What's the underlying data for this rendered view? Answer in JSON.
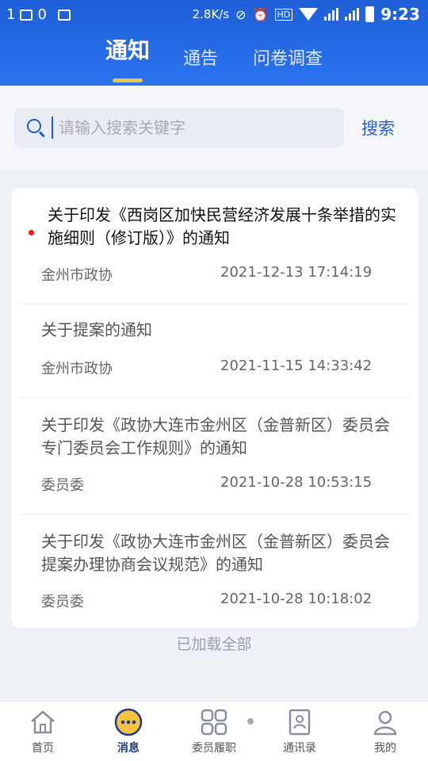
{
  "status_bar": {
    "left_text": "1",
    "left_text2": "0",
    "speed": "2.8K/s",
    "time": "9:23"
  },
  "tabs": [
    {
      "label": "通知",
      "active": true
    },
    {
      "label": "通告",
      "active": false
    },
    {
      "label": "问卷调查",
      "active": false
    }
  ],
  "search": {
    "placeholder": "请输入搜索关键字",
    "value": "",
    "button_label": "搜索"
  },
  "notices": [
    {
      "title": "关于印发《西岗区加快民营经济发展十条举措的实施细则（修订版）》的通知",
      "source": "金州市政协",
      "time": "2021-12-13 17:14:19",
      "unread": true
    },
    {
      "title": "关于提案的通知",
      "source": "金州市政协",
      "time": "2021-11-15 14:33:42",
      "unread": false
    },
    {
      "title": "关于印发《政协大连市金州区（金普新区）委员会专门委员会工作规则》的通知",
      "source": "委员委",
      "time": "2021-10-28 10:53:15",
      "unread": false
    },
    {
      "title": "关于印发《政协大连市金州区（金普新区）委员会提案办理协商会议规范》的通知",
      "source": "委员委",
      "time": "2021-10-28 10:18:02",
      "unread": false
    }
  ],
  "list_footer": "已加载全部",
  "bottom_nav": [
    {
      "label": "首页",
      "icon": "home-icon"
    },
    {
      "label": "消息",
      "icon": "message-icon",
      "active": true
    },
    {
      "label": "委员履职",
      "icon": "grid-icon"
    },
    {
      "label": "通讯录",
      "icon": "contacts-icon"
    },
    {
      "label": "我的",
      "icon": "profile-icon"
    }
  ],
  "colors": {
    "header": "#2b73ef",
    "accent": "#1d5fd3",
    "tab_underline": "#f5c343",
    "unread_dot": "#e02020"
  }
}
